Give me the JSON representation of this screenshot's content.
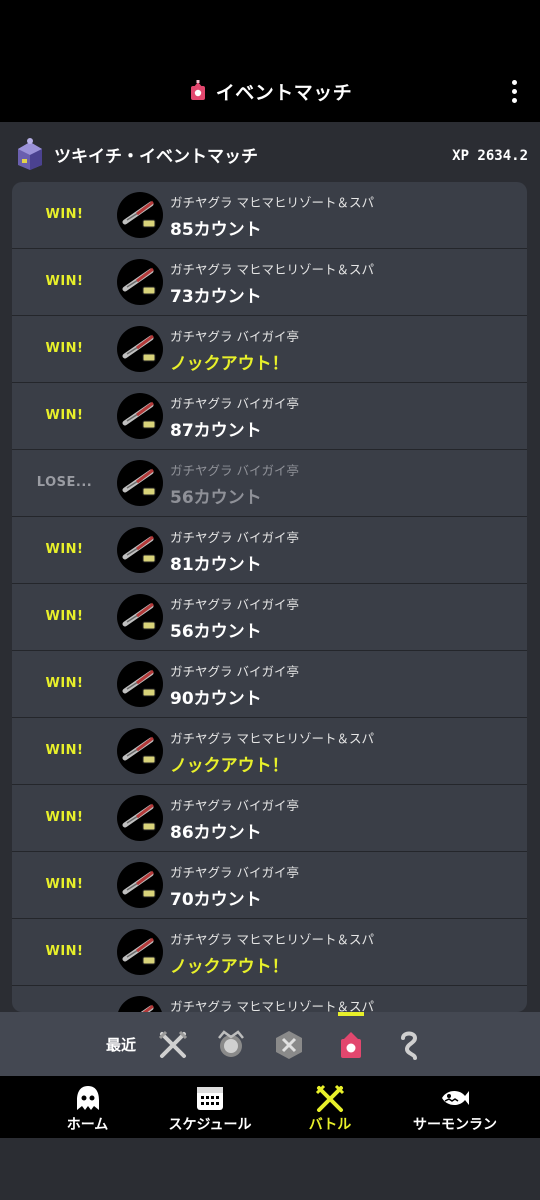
{
  "colors": {
    "accent": "#e8f02a",
    "brand": "#e2476e",
    "lose": "#9a9ca3"
  },
  "appbar": {
    "title": "イベントマッチ",
    "icon": "event-match-icon"
  },
  "section": {
    "title": "ツキイチ・イベントマッチ",
    "power": "XP 2634.2",
    "icon": "event-emblem-icon"
  },
  "battles": [
    {
      "result": "WIN!",
      "stage": "ガチヤグラ マヒマヒリゾート＆スパ",
      "score": "85カウント",
      "ko": false
    },
    {
      "result": "WIN!",
      "stage": "ガチヤグラ マヒマヒリゾート＆スパ",
      "score": "73カウント",
      "ko": false
    },
    {
      "result": "WIN!",
      "stage": "ガチヤグラ バイガイ亭",
      "score": "ノックアウト！",
      "ko": true
    },
    {
      "result": "WIN!",
      "stage": "ガチヤグラ バイガイ亭",
      "score": "87カウント",
      "ko": false
    },
    {
      "result": "LOSE...",
      "stage": "ガチヤグラ バイガイ亭",
      "score": "56カウント",
      "ko": false,
      "lose": true
    },
    {
      "result": "WIN!",
      "stage": "ガチヤグラ バイガイ亭",
      "score": "81カウント",
      "ko": false
    },
    {
      "result": "WIN!",
      "stage": "ガチヤグラ バイガイ亭",
      "score": "56カウント",
      "ko": false
    },
    {
      "result": "WIN!",
      "stage": "ガチヤグラ バイガイ亭",
      "score": "90カウント",
      "ko": false
    },
    {
      "result": "WIN!",
      "stage": "ガチヤグラ マヒマヒリゾート＆スパ",
      "score": "ノックアウト！",
      "ko": true
    },
    {
      "result": "WIN!",
      "stage": "ガチヤグラ バイガイ亭",
      "score": "86カウント",
      "ko": false
    },
    {
      "result": "WIN!",
      "stage": "ガチヤグラ バイガイ亭",
      "score": "70カウント",
      "ko": false
    },
    {
      "result": "WIN!",
      "stage": "ガチヤグラ マヒマヒリゾート＆スパ",
      "score": "ノックアウト！",
      "ko": true
    },
    {
      "result": "",
      "stage": "ガチヤグラ マヒマヒリゾート＆スパ",
      "score": "",
      "ko": false
    }
  ],
  "filters": {
    "recent_label": "最近",
    "items": [
      "regular-battle-icon",
      "bankara-battle-icon",
      "x-battle-icon",
      "event-match-icon",
      "private-match-icon"
    ],
    "selected": "event-match-icon"
  },
  "tabs": [
    {
      "label": "ホーム",
      "icon": "squid-home-icon"
    },
    {
      "label": "スケジュール",
      "icon": "calendar-icon"
    },
    {
      "label": "バトル",
      "icon": "battle-icon",
      "active": true
    },
    {
      "label": "サーモンラン",
      "icon": "salmon-icon"
    }
  ]
}
